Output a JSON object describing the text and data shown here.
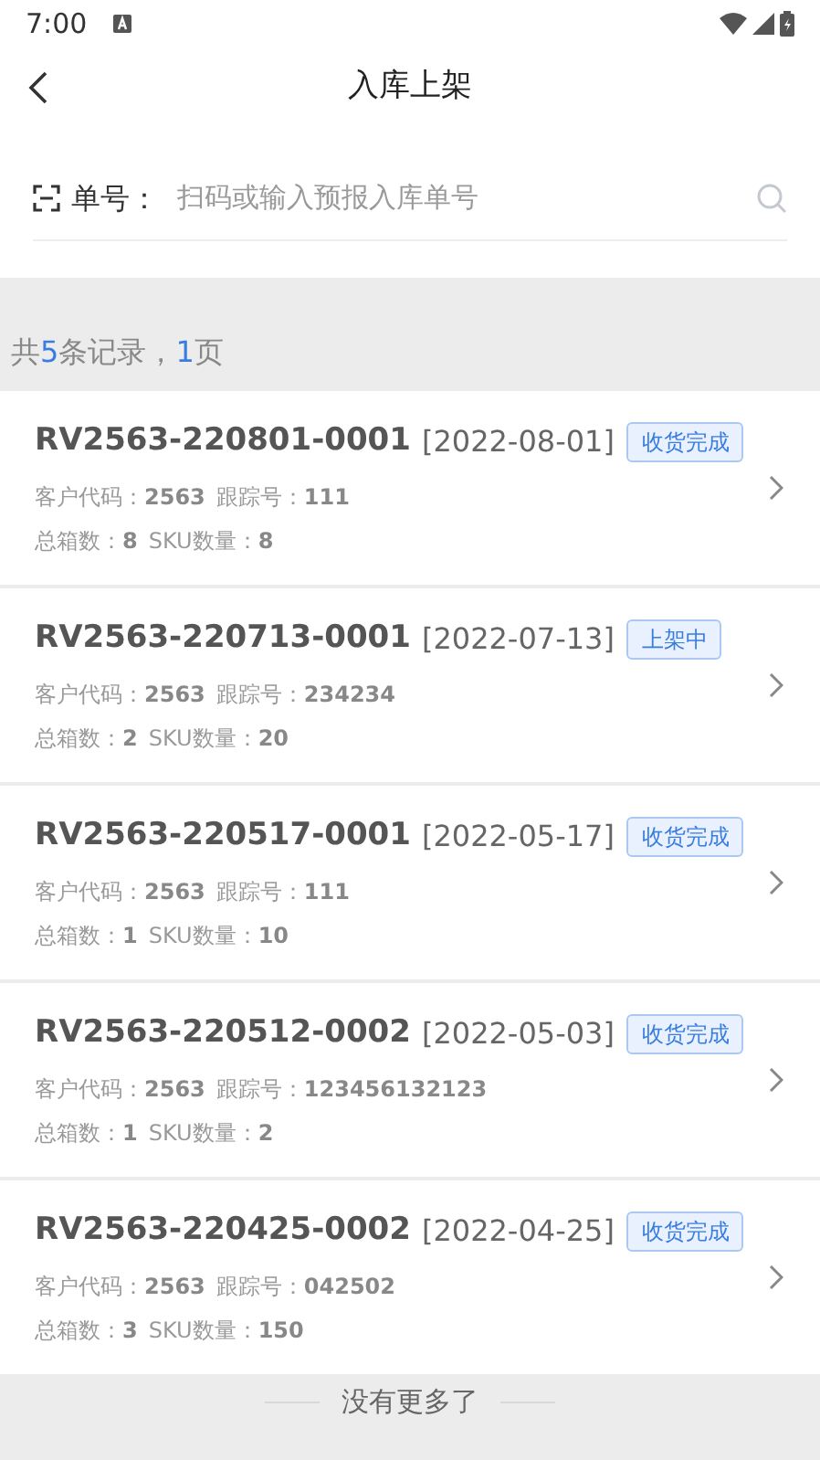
{
  "status_bar": {
    "time": "7:00"
  },
  "header": {
    "title": "入库上架"
  },
  "search": {
    "label": "单号：",
    "placeholder": "扫码或输入预报入库单号"
  },
  "summary": [
    {
      "text": "共",
      "highlight": false
    },
    {
      "text": "5",
      "highlight": true
    },
    {
      "text": "条记录，",
      "highlight": false
    },
    {
      "text": "1",
      "highlight": true
    },
    {
      "text": "页",
      "highlight": false
    }
  ],
  "records": [
    {
      "order_no": "RV2563-220801-0001",
      "date": "[2022-08-01]",
      "status": "收货完成",
      "lines": [
        [
          {
            "label": "客户代码：",
            "value": "2563"
          },
          {
            "label": "跟踪号：",
            "value": "111"
          }
        ],
        [
          {
            "label": "总箱数：",
            "value": "8"
          },
          {
            "label": "SKU数量：",
            "value": "8"
          }
        ]
      ]
    },
    {
      "order_no": "RV2563-220713-0001",
      "date": "[2022-07-13]",
      "status": "上架中",
      "lines": [
        [
          {
            "label": "客户代码：",
            "value": "2563"
          },
          {
            "label": "跟踪号：",
            "value": "234234"
          }
        ],
        [
          {
            "label": "总箱数：",
            "value": "2"
          },
          {
            "label": "SKU数量：",
            "value": "20"
          }
        ]
      ]
    },
    {
      "order_no": "RV2563-220517-0001",
      "date": "[2022-05-17]",
      "status": "收货完成",
      "lines": [
        [
          {
            "label": "客户代码：",
            "value": "2563"
          },
          {
            "label": "跟踪号：",
            "value": "111"
          }
        ],
        [
          {
            "label": "总箱数：",
            "value": "1"
          },
          {
            "label": "SKU数量：",
            "value": "10"
          }
        ]
      ]
    },
    {
      "order_no": "RV2563-220512-0002",
      "date": "[2022-05-03]",
      "status": "收货完成",
      "lines": [
        [
          {
            "label": "客户代码：",
            "value": "2563"
          },
          {
            "label": "跟踪号：",
            "value": "123456132123"
          }
        ],
        [
          {
            "label": "总箱数：",
            "value": "1"
          },
          {
            "label": "SKU数量：",
            "value": "2"
          }
        ]
      ]
    },
    {
      "order_no": "RV2563-220425-0002",
      "date": "[2022-04-25]",
      "status": "收货完成",
      "lines": [
        [
          {
            "label": "客户代码：",
            "value": "2563"
          },
          {
            "label": "跟踪号：",
            "value": "042502"
          }
        ],
        [
          {
            "label": "总箱数：",
            "value": "3"
          },
          {
            "label": "SKU数量：",
            "value": "150"
          }
        ]
      ]
    }
  ],
  "footer": {
    "text": "没有更多了"
  }
}
